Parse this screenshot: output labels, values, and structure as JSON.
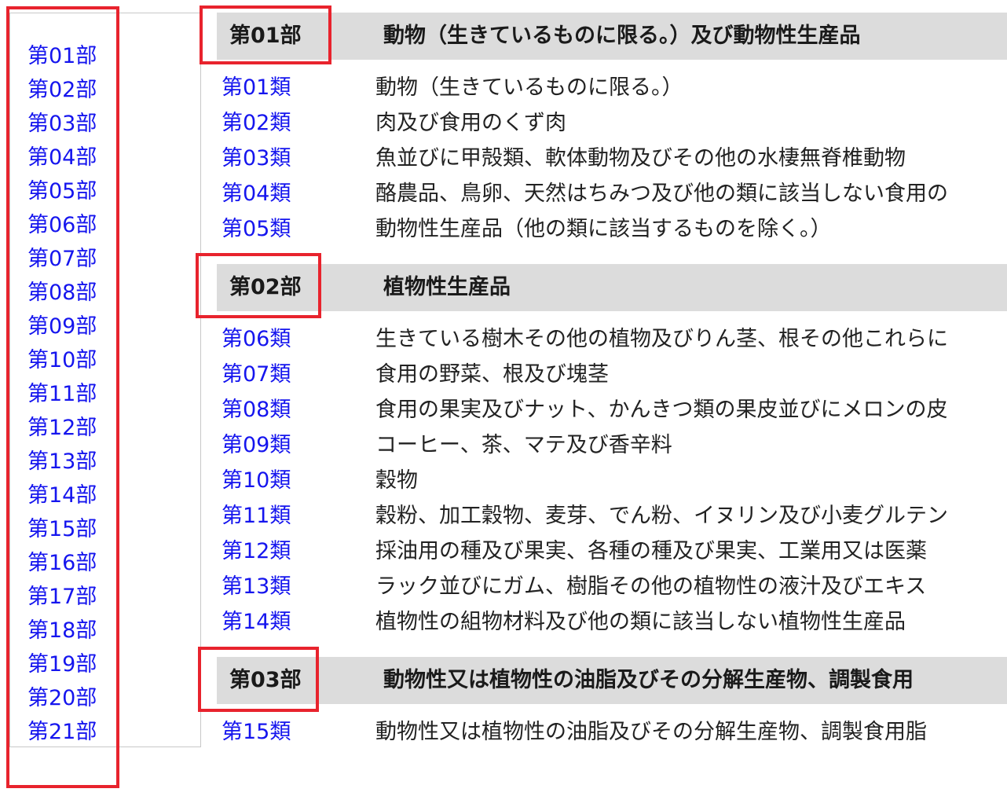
{
  "sidebar": {
    "items": [
      {
        "label": "第01部"
      },
      {
        "label": "第02部"
      },
      {
        "label": "第03部"
      },
      {
        "label": "第04部"
      },
      {
        "label": "第05部"
      },
      {
        "label": "第06部"
      },
      {
        "label": "第07部"
      },
      {
        "label": "第08部"
      },
      {
        "label": "第09部"
      },
      {
        "label": "第10部"
      },
      {
        "label": "第11部"
      },
      {
        "label": "第12部"
      },
      {
        "label": "第13部"
      },
      {
        "label": "第14部"
      },
      {
        "label": "第15部"
      },
      {
        "label": "第16部"
      },
      {
        "label": "第17部"
      },
      {
        "label": "第18部"
      },
      {
        "label": "第19部"
      },
      {
        "label": "第20部"
      },
      {
        "label": "第21部"
      }
    ]
  },
  "sections": [
    {
      "id": "第01部",
      "title": "動物（生きているものに限る。）及び動物性生産品",
      "chapters": [
        {
          "code": "第01類",
          "desc": "動物（生きているものに限る。）"
        },
        {
          "code": "第02類",
          "desc": "肉及び食用のくず肉"
        },
        {
          "code": "第03類",
          "desc": "魚並びに甲殻類、軟体動物及びその他の水棲無脊椎動物"
        },
        {
          "code": "第04類",
          "desc": "酪農品、鳥卵、天然はちみつ及び他の類に該当しない食用の"
        },
        {
          "code": "第05類",
          "desc": "動物性生産品（他の類に該当するものを除く。）"
        }
      ]
    },
    {
      "id": "第02部",
      "title": "植物性生産品",
      "chapters": [
        {
          "code": "第06類",
          "desc": "生きている樹木その他の植物及びりん茎、根その他これらに"
        },
        {
          "code": "第07類",
          "desc": "食用の野菜、根及び塊茎"
        },
        {
          "code": "第08類",
          "desc": "食用の果実及びナット、かんきつ類の果皮並びにメロンの皮"
        },
        {
          "code": "第09類",
          "desc": "コーヒー、茶、マテ及び香辛料"
        },
        {
          "code": "第10類",
          "desc": "穀物"
        },
        {
          "code": "第11類",
          "desc": "穀粉、加工穀物、麦芽、でん粉、イヌリン及び小麦グルテン"
        },
        {
          "code": "第12類",
          "desc": "採油用の種及び果実、各種の種及び果実、工業用又は医薬"
        },
        {
          "code": "第13類",
          "desc": "ラック並びにガム、樹脂その他の植物性の液汁及びエキス"
        },
        {
          "code": "第14類",
          "desc": "植物性の組物材料及び他の類に該当しない植物性生産品"
        }
      ]
    },
    {
      "id": "第03部",
      "title": "動物性又は植物性の油脂及びその分解生産物、調製食用",
      "chapters": [
        {
          "code": "第15類",
          "desc": "動物性又は植物性の油脂及びその分解生産物、調製食用脂"
        }
      ]
    }
  ],
  "colors": {
    "link": "#1515ee",
    "highlight": "#e8232d",
    "header_bg": "#dcdcdc"
  }
}
